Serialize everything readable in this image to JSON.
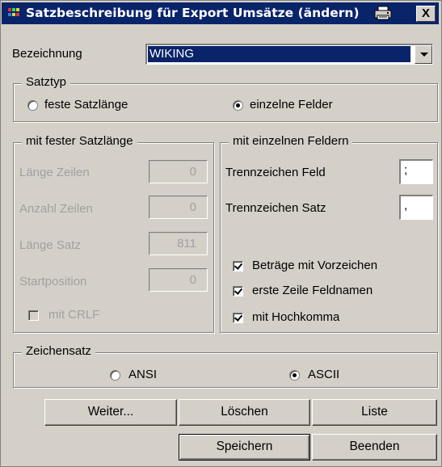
{
  "window": {
    "title": "Satzbeschreibung für Export Umsätze (ändern)",
    "close_label": "X"
  },
  "bezeichnung": {
    "label": "Bezeichnung",
    "value": "WIKING"
  },
  "satztyp": {
    "legend": "Satztyp",
    "option_fest": "feste Satzlänge",
    "option_einzeln": "einzelne Felder",
    "selected": "einzelne Felder"
  },
  "fest": {
    "legend": "mit fester Satzlänge",
    "laenge_zeilen_label": "Länge Zeilen",
    "laenge_zeilen_value": "0",
    "anzahl_zeilen_label": "Anzahl Zeilen",
    "anzahl_zeilen_value": "0",
    "laenge_satz_label": "Länge Satz",
    "laenge_satz_value": "811",
    "startposition_label": "Startposition",
    "startposition_value": "0",
    "crlf_label": "mit CRLF"
  },
  "einzeln": {
    "legend": "mit einzelnen Feldern",
    "trennzeichen_feld_label": "Trennzeichen Feld",
    "trennzeichen_feld_value": ";",
    "trennzeichen_satz_label": "Trennzeichen Satz",
    "trennzeichen_satz_value": ",",
    "vorzeichen_label": "Beträge mit Vorzeichen",
    "feldnamen_label": "erste Zeile Feldnamen",
    "hochkomma_label": "mit Hochkomma"
  },
  "zeichensatz": {
    "legend": "Zeichensatz",
    "option_ansi": "ANSI",
    "option_ascii": "ASCII",
    "selected": "ASCII"
  },
  "buttons": {
    "weiter": "Weiter...",
    "loeschen": "Löschen",
    "liste": "Liste",
    "speichern": "Speichern",
    "beenden": "Beenden"
  },
  "icons": {
    "app": "app-icon",
    "print": "printer-icon",
    "close": "close-icon"
  }
}
